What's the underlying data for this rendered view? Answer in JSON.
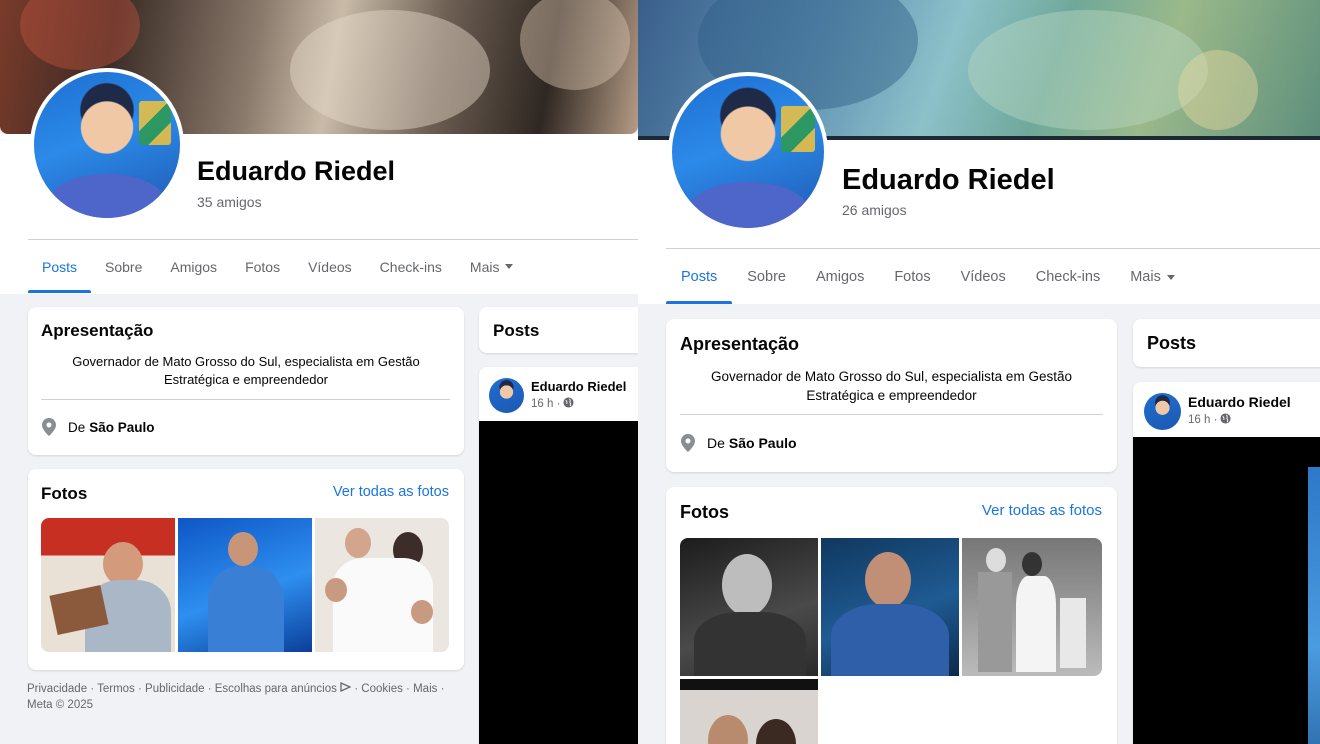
{
  "profiles": [
    {
      "name": "Eduardo Riedel",
      "friends": "35 amigos",
      "tabs": [
        "Posts",
        "Sobre",
        "Amigos",
        "Fotos",
        "Vídeos",
        "Check-ins",
        "Mais"
      ],
      "intro": {
        "title": "Apresentação",
        "bio_line1": "Governador de Mato Grosso do Sul, especialista em Gestão",
        "bio_line2": "Estratégica e empreendedor",
        "location_prefix": "De",
        "location": "São Paulo"
      },
      "photos": {
        "title": "Fotos",
        "see_all": "Ver todas as fotos"
      },
      "posts_title": "Posts",
      "post": {
        "author": "Eduardo Riedel",
        "time": "16 h ·"
      },
      "footer": {
        "links": [
          "Privacidade",
          "Termos",
          "Publicidade",
          "Escolhas para anúncios",
          "Cookies",
          "Mais"
        ],
        "copyright": "Meta © 2025"
      }
    },
    {
      "name": "Eduardo Riedel",
      "friends": "26 amigos",
      "tabs": [
        "Posts",
        "Sobre",
        "Amigos",
        "Fotos",
        "Vídeos",
        "Check-ins",
        "Mais"
      ],
      "intro": {
        "title": "Apresentação",
        "bio_line1": "Governador de Mato Grosso do Sul, especialista em Gestão",
        "bio_line2": "Estratégica e empreendedor",
        "location_prefix": "De",
        "location": "São Paulo"
      },
      "photos": {
        "title": "Fotos",
        "see_all": "Ver todas as fotos"
      },
      "posts_title": "Posts",
      "post": {
        "author": "Eduardo Riedel",
        "time": "16 h ·"
      }
    }
  ],
  "icons": {
    "location": "map-pin-icon",
    "privacy": "globe-icon",
    "dropdown": "caret-down-icon",
    "ad_choices": "ad-choices-icon"
  },
  "colors": {
    "accent": "#1b74e4",
    "secondary_text": "#65676b",
    "background": "#f0f2f5"
  }
}
